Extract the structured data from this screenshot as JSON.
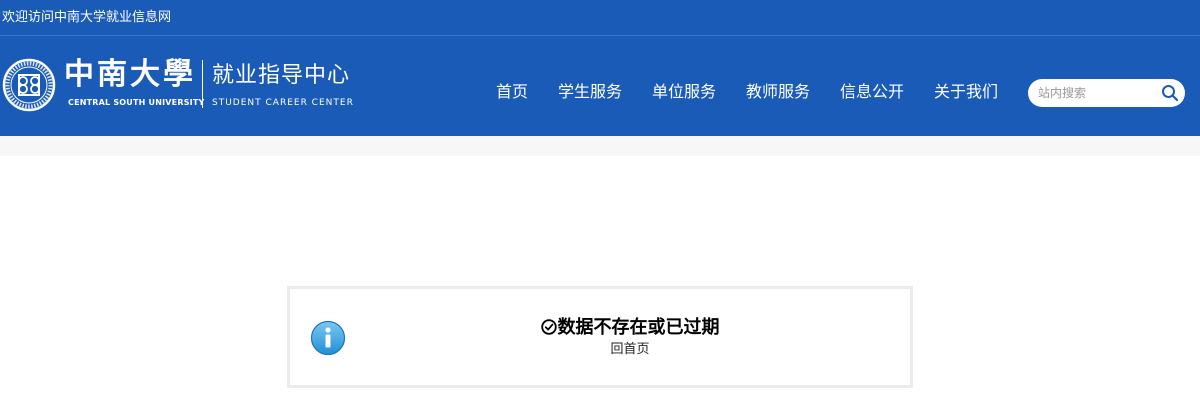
{
  "topbar": {
    "welcome": "欢迎访问中南大学就业信息网"
  },
  "header": {
    "university_cn": "中南大學",
    "university_en": "CENTRAL SOUTH UNIVERSITY",
    "center_cn": "就业指导中心",
    "center_en": "STUDENT CAREER CENTER"
  },
  "nav": [
    {
      "label": "首页"
    },
    {
      "label": "学生服务"
    },
    {
      "label": "单位服务"
    },
    {
      "label": "教师服务"
    },
    {
      "label": "信息公开"
    },
    {
      "label": "关于我们"
    }
  ],
  "search": {
    "placeholder": "站内搜索",
    "icon": "search-icon"
  },
  "message": {
    "title": "数据不存在或已过期",
    "link": "回首页",
    "icon": "info-icon",
    "title_icon": "check-circle-icon"
  },
  "colors": {
    "header_bg": "#1a5bb7",
    "info_icon": "#2d9fe0"
  }
}
